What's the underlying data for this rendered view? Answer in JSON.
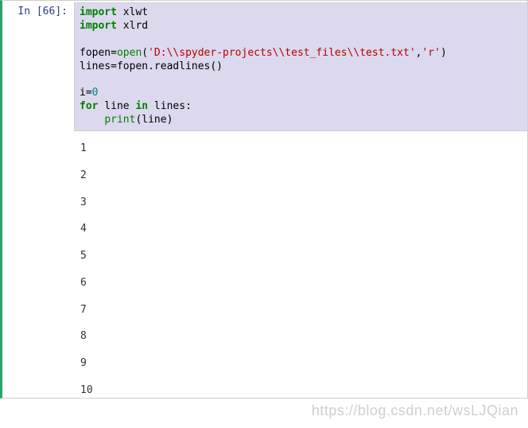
{
  "prompt": {
    "label": "In [66]:"
  },
  "code": {
    "tokens": {
      "import1": "import",
      "mod1": " xlwt",
      "import2": "import",
      "mod2": " xlrd",
      "fopen_lhs": "fopen=",
      "open_fn": "open",
      "open_paren1": "(",
      "path_str": "'D:\\\\spyder-projects\\\\test_files\\\\test.txt'",
      "comma": ",",
      "mode_str": "'r'",
      "close_paren1": ")",
      "lines_assign": "lines=fopen.readlines()",
      "i_lhs": "i=",
      "zero": "0",
      "for_kw": "for",
      "for_mid": " line ",
      "in_kw": "in",
      "for_end": " lines:",
      "indent": "    ",
      "print_fn": "print",
      "print_args": "(line)"
    }
  },
  "output": {
    "lines": [
      "1",
      "2",
      "3",
      "4",
      "5",
      "6",
      "7",
      "8",
      "9",
      "10"
    ]
  },
  "watermark": "https://blog.csdn.net/wsLJQian"
}
